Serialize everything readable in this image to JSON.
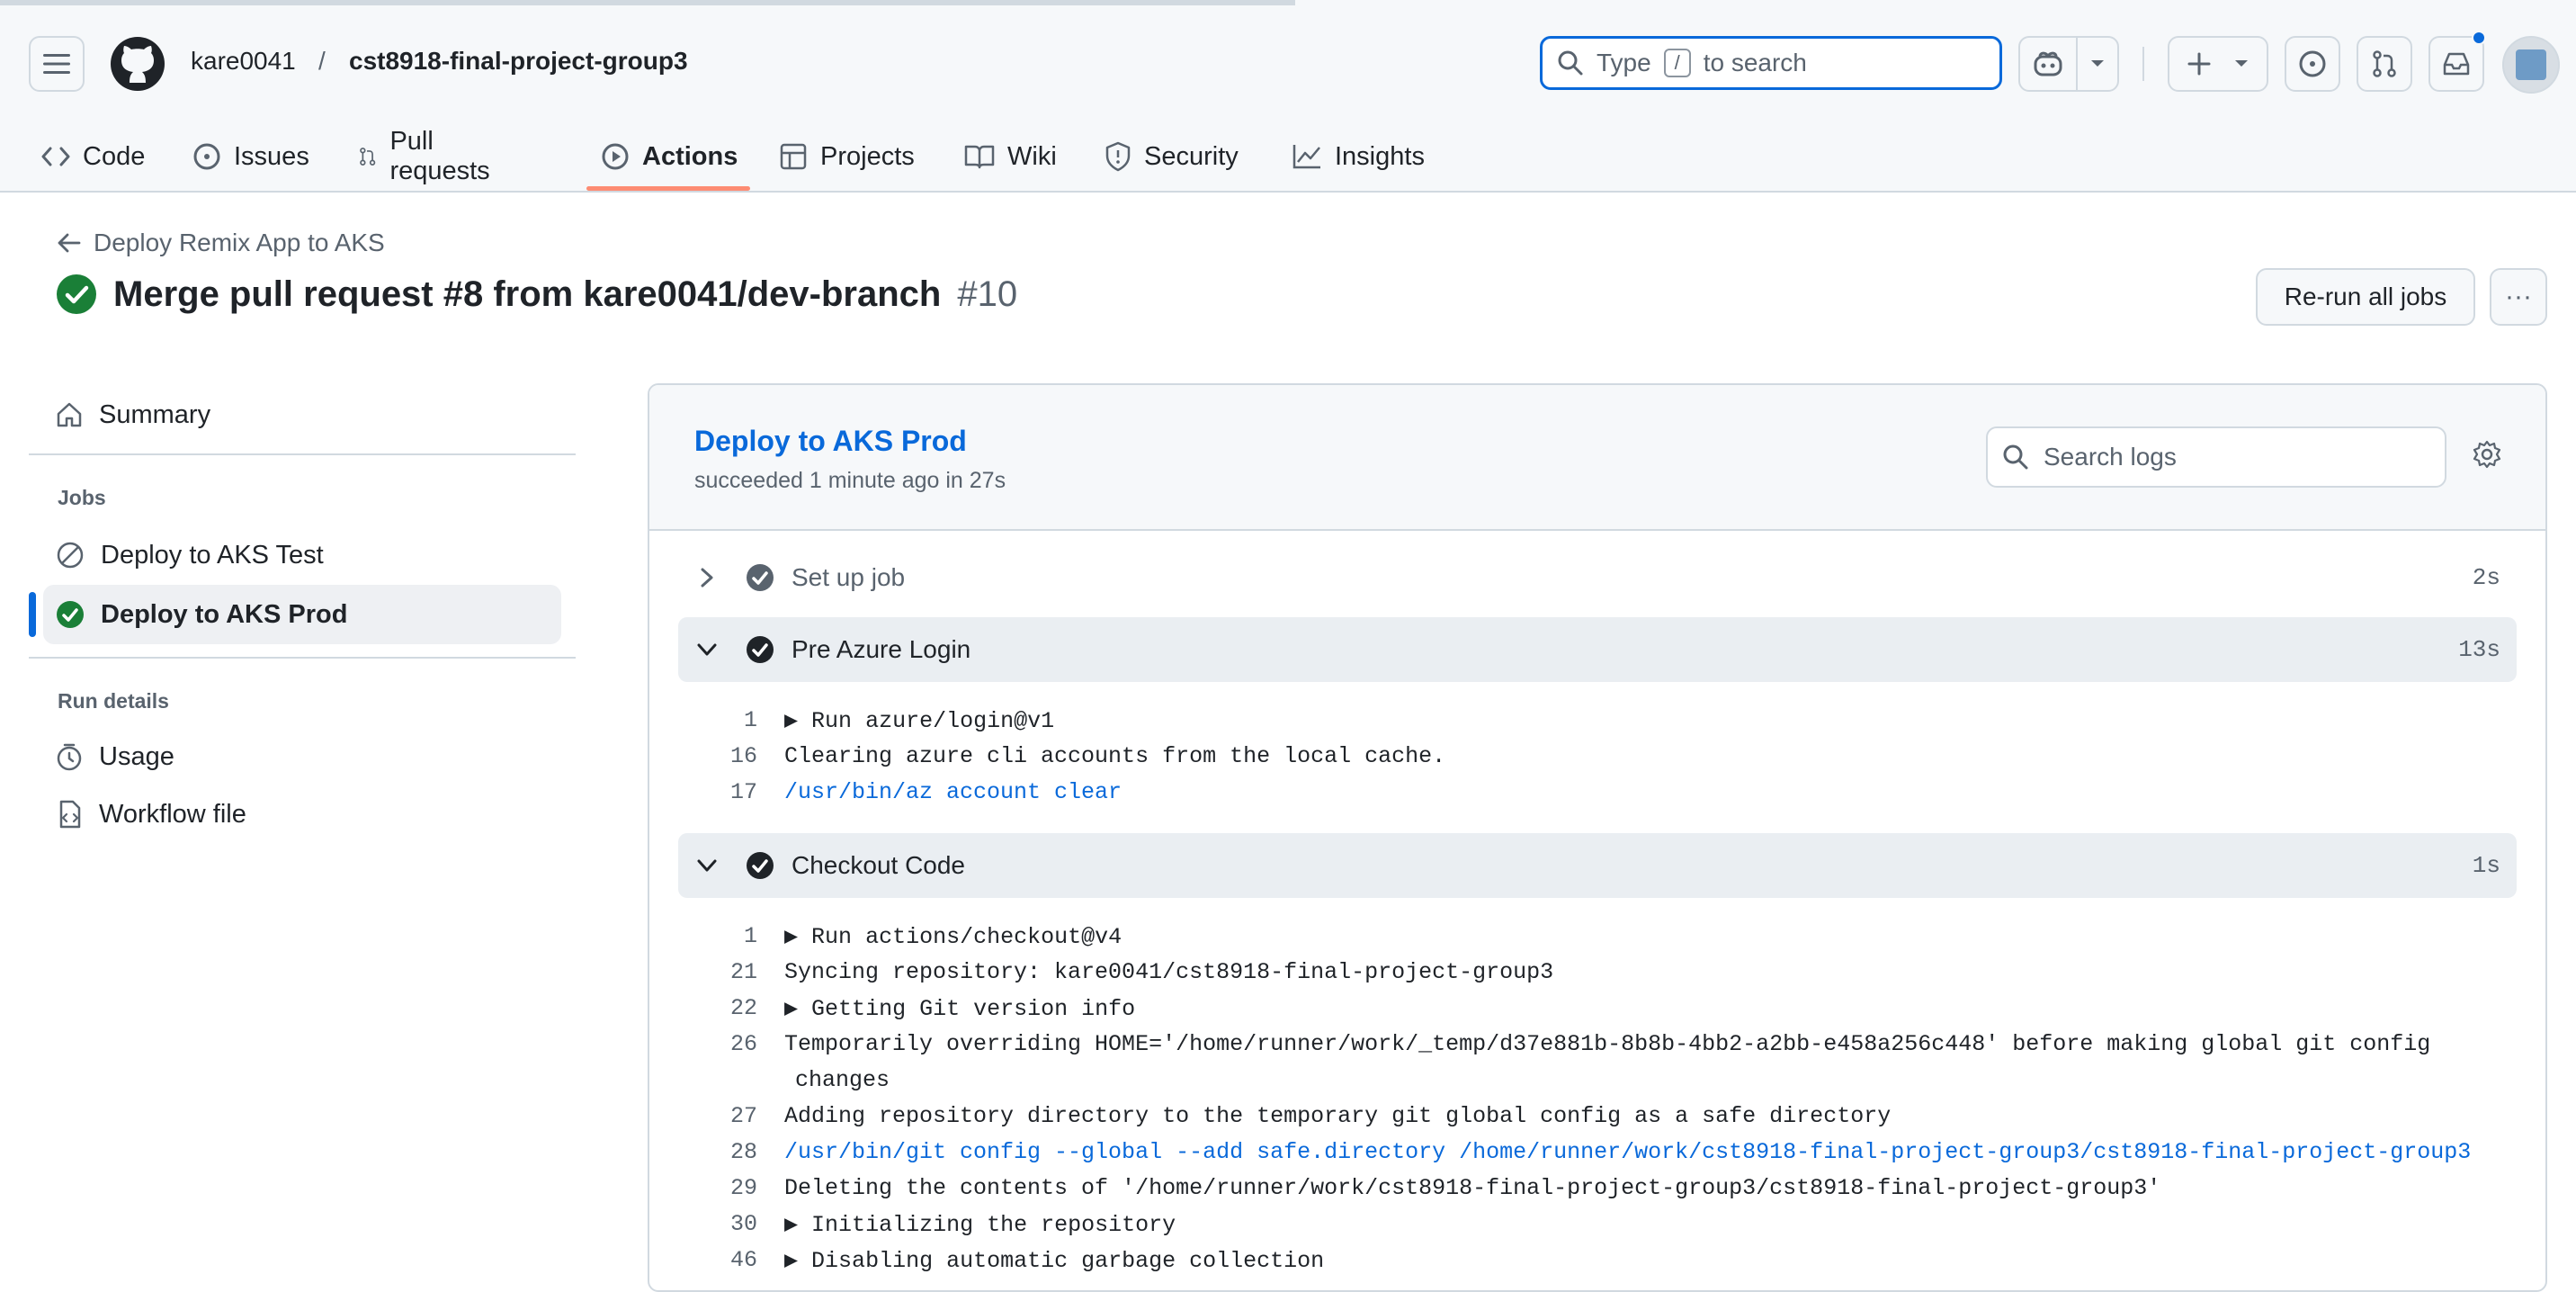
{
  "header": {
    "owner": "kare0041",
    "separator": "/",
    "repo": "cst8918-final-project-group3",
    "search_prefix": "Type",
    "search_key": "/",
    "search_suffix": "to search"
  },
  "tabs": [
    {
      "label": "Code",
      "icon": "code-icon"
    },
    {
      "label": "Issues",
      "icon": "issue-icon"
    },
    {
      "label": "Pull requests",
      "icon": "pull-request-icon"
    },
    {
      "label": "Actions",
      "icon": "play-icon",
      "active": true
    },
    {
      "label": "Projects",
      "icon": "table-icon"
    },
    {
      "label": "Wiki",
      "icon": "book-icon"
    },
    {
      "label": "Security",
      "icon": "shield-icon"
    },
    {
      "label": "Insights",
      "icon": "graph-icon"
    }
  ],
  "run": {
    "back_label": "Deploy Remix App to AKS",
    "title": "Merge pull request #8 from kare0041/dev-branch",
    "number": "#10",
    "rerun_label": "Re-run all jobs",
    "more_label": "···"
  },
  "sidebar": {
    "summary": "Summary",
    "jobs_heading": "Jobs",
    "jobs": [
      {
        "label": "Deploy to AKS Test",
        "status": "skipped"
      },
      {
        "label": "Deploy to AKS Prod",
        "status": "success",
        "selected": true
      }
    ],
    "details_heading": "Run details",
    "details": [
      {
        "label": "Usage",
        "icon": "stopwatch-icon"
      },
      {
        "label": "Workflow file",
        "icon": "file-code-icon"
      }
    ]
  },
  "job": {
    "title": "Deploy to AKS Prod",
    "subtitle": "succeeded 1 minute ago in 27s",
    "search_placeholder": "Search logs"
  },
  "steps": [
    {
      "name": "Set up job",
      "duration": "2s",
      "expanded": false
    },
    {
      "name": "Pre Azure Login",
      "duration": "13s",
      "expanded": true,
      "lines": [
        {
          "n": "1",
          "text": "▶ Run azure/login@v1",
          "cmd": false
        },
        {
          "n": "16",
          "text": "Clearing azure cli accounts from the local cache.",
          "cmd": false
        },
        {
          "n": "17",
          "text": "/usr/bin/az account clear",
          "cmd": true
        }
      ]
    },
    {
      "name": "Checkout Code",
      "duration": "1s",
      "expanded": true,
      "lines": [
        {
          "n": "1",
          "text": "▶ Run actions/checkout@v4",
          "cmd": false
        },
        {
          "n": "21",
          "text": "Syncing repository: kare0041/cst8918-final-project-group3",
          "cmd": false
        },
        {
          "n": "22",
          "text": "▶ Getting Git version info",
          "cmd": false
        },
        {
          "n": "26",
          "text": "Temporarily overriding HOME='/home/runner/work/_temp/d37e881b-8b8b-4bb2-a2bb-e458a256c448' before making global git config",
          "cmd": false,
          "cont": "changes"
        },
        {
          "n": "27",
          "text": "Adding repository directory to the temporary git global config as a safe directory",
          "cmd": false
        },
        {
          "n": "28",
          "text": "/usr/bin/git config --global --add safe.directory /home/runner/work/cst8918-final-project-group3/cst8918-final-project-group3",
          "cmd": true
        },
        {
          "n": "29",
          "text": "Deleting the contents of '/home/runner/work/cst8918-final-project-group3/cst8918-final-project-group3'",
          "cmd": false
        },
        {
          "n": "30",
          "text": "▶ Initializing the repository",
          "cmd": false
        },
        {
          "n": "46",
          "text": "▶ Disabling automatic garbage collection",
          "cmd": false
        }
      ]
    }
  ],
  "colors": {
    "accent": "#0969da",
    "success": "#1a7f37",
    "tab_underline": "#fd8c73"
  }
}
